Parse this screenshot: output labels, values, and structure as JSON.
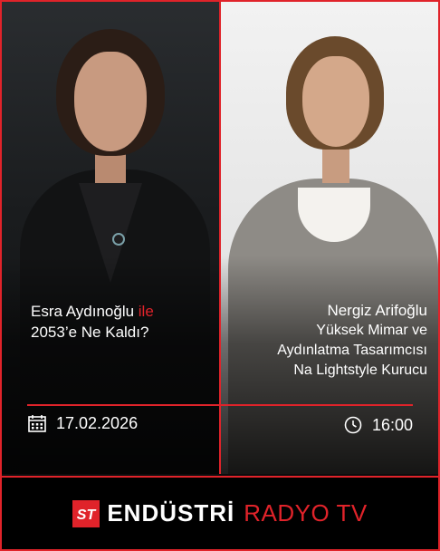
{
  "left": {
    "title_name": "Esra Aydınoğlu",
    "title_connector": "ile",
    "title_line2": "2053’e Ne Kaldı?",
    "date": "17.02.2026",
    "date_icon": "calendar-icon"
  },
  "right": {
    "name": "Nergiz Arifoğlu",
    "role_line1": "Yüksek Mimar ve",
    "role_line2": "Aydınlatma Tasarımcısı",
    "role_line3": "Na Lightstyle Kurucu",
    "time": "16:00",
    "time_icon": "clock-icon"
  },
  "footer": {
    "logo_text": "ST",
    "brand_main": "ENDÜSTRİ",
    "brand_accent": "RADYO TV"
  },
  "colors": {
    "accent": "#e0232a",
    "background": "#000000",
    "text": "#ffffff"
  }
}
